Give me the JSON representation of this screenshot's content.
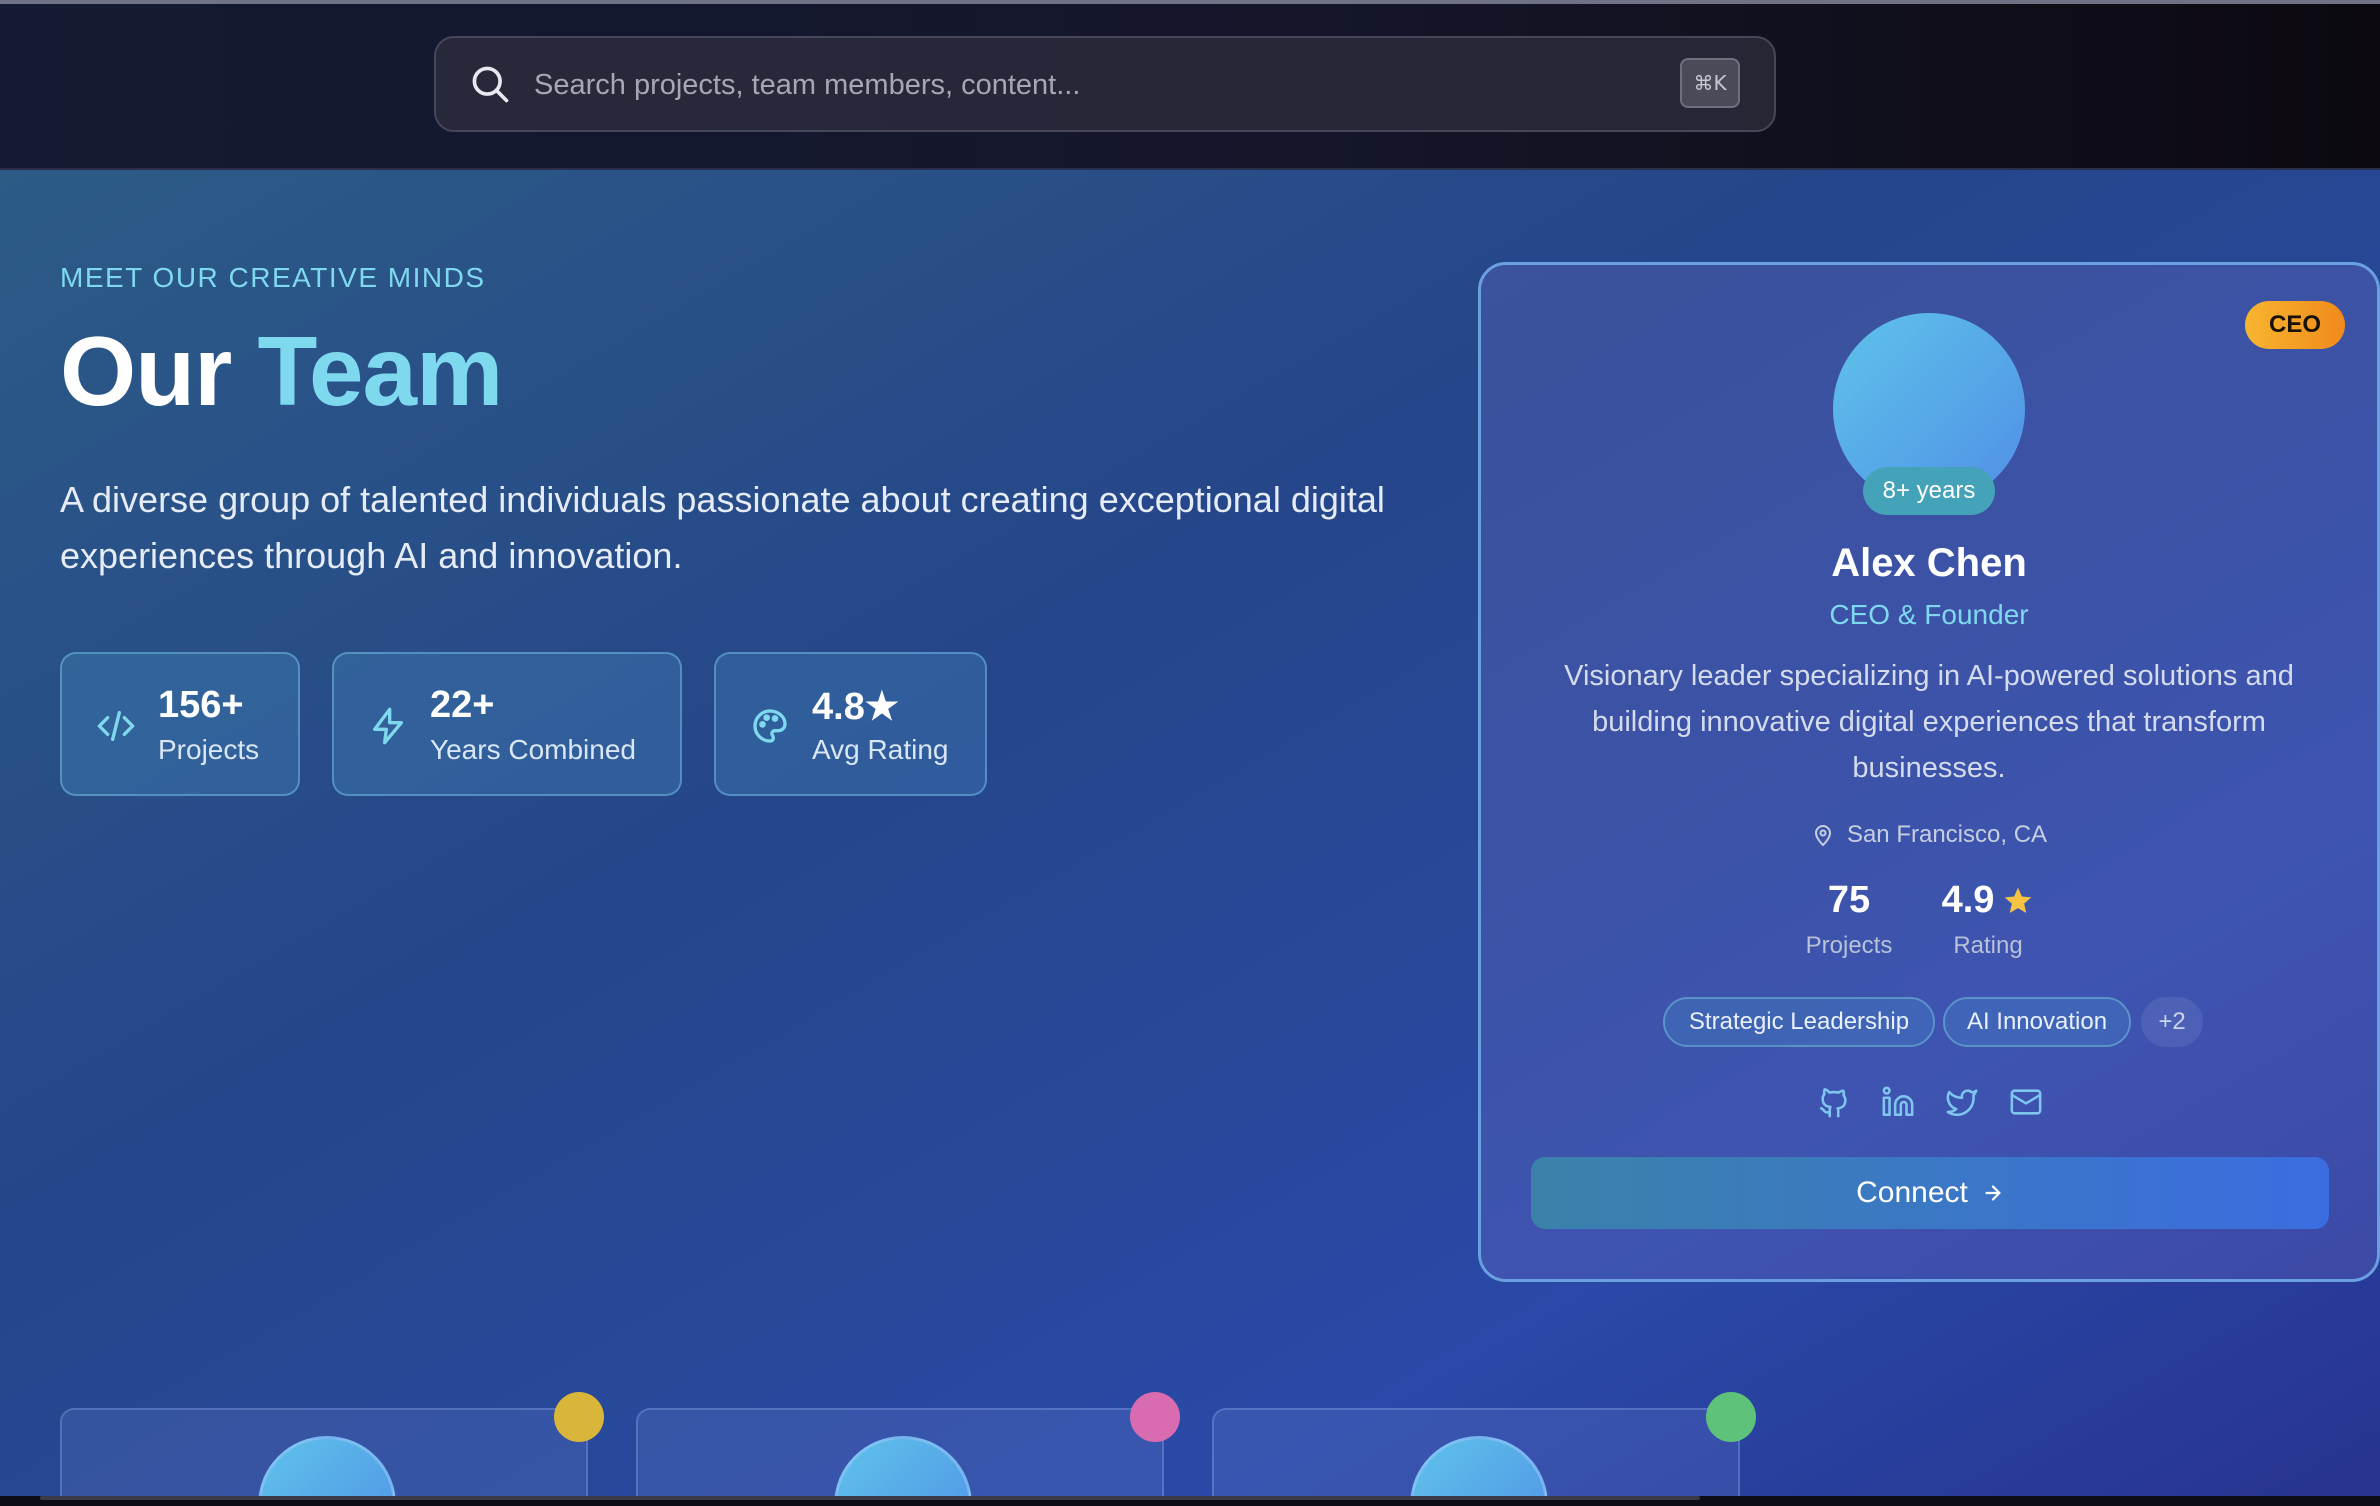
{
  "search": {
    "placeholder": "Search projects, team members, content...",
    "shortcut": "⌘K",
    "icon": "search-icon"
  },
  "hero": {
    "eyebrow": "MEET OUR CREATIVE MINDS",
    "title_plain": "Our",
    "title_accent": "Team",
    "description": "A diverse group of talented individuals passionate about creating exceptional digital experiences through AI and innovation."
  },
  "stats": [
    {
      "icon": "code-icon",
      "value": "156+",
      "label": "Projects"
    },
    {
      "icon": "lightning-icon",
      "value": "22+",
      "label": "Years Combined"
    },
    {
      "icon": "palette-icon",
      "value": "4.8★",
      "label": "Avg Rating"
    }
  ],
  "featured": {
    "badge": "CEO",
    "experience": "8+ years",
    "name": "Alex Chen",
    "role": "CEO & Founder",
    "bio": "Visionary leader specializing in AI-powered solutions and building innovative digital experiences that transform businesses.",
    "location": "San Francisco, CA",
    "projects_value": "75",
    "projects_label": "Projects",
    "rating_value": "4.9",
    "rating_label": "Rating",
    "skills": [
      "Strategic Leadership",
      "AI Innovation"
    ],
    "more_skills": "+2",
    "socials": [
      "github-icon",
      "linkedin-icon",
      "twitter-icon",
      "mail-icon"
    ],
    "connect_label": "Connect"
  },
  "colors": {
    "accent": "#7fd9ee",
    "badge": "#f7b52f",
    "star": "#f5c542",
    "dot_1": "#d9b53a",
    "dot_2": "#d96cb0",
    "dot_3": "#5fc27a"
  }
}
